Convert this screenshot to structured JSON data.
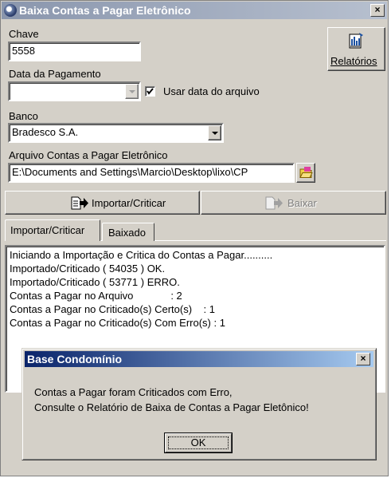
{
  "window": {
    "title": "Baixa Contas a Pagar Eletrônico",
    "close_label": "×"
  },
  "form": {
    "chave_label": "Chave",
    "chave_value": "5558",
    "relatorios_label": "Relatórios",
    "data_pagamento_label": "Data da Pagamento",
    "data_pagamento_value": "",
    "usar_data_label": "Usar data do arquivo",
    "usar_data_checked": true,
    "banco_label": "Banco",
    "banco_value": "Bradesco S.A.",
    "arquivo_label": "Arquivo Contas a Pagar Eletrônico",
    "arquivo_value": "E:\\Documents and Settings\\Marcio\\Desktop\\lixo\\CP"
  },
  "actions": {
    "importar_label": "Importar/Criticar",
    "baixar_label": "Baixar"
  },
  "tabs": [
    {
      "label": "Importar/Criticar",
      "active": true
    },
    {
      "label": "Baixado",
      "active": false
    }
  ],
  "log": {
    "lines": [
      "Iniciando a Importação e Critica do Contas a Pagar..........",
      "Importado/Criticado ( 54035 ) OK.",
      "Importado/Criticado ( 53771 ) ERRO.",
      "Contas a Pagar no Arquivo             : 2",
      "Contas a Pagar no Criticado(s) Certo(s)    : 1",
      "Contas a Pagar no Criticado(s) Com Erro(s) : 1"
    ]
  },
  "dialog": {
    "title": "Base Condomínio",
    "close_label": "×",
    "message_line1": "Contas a Pagar foram Criticados com Erro,",
    "message_line2": "Consulte o Relatório de Baixa de Contas a Pagar Eletônico!",
    "ok_label": "OK"
  },
  "colors": {
    "face": "#d4d0c8",
    "active_title": "#0a246a",
    "inactive_title": "#8a96ad"
  }
}
